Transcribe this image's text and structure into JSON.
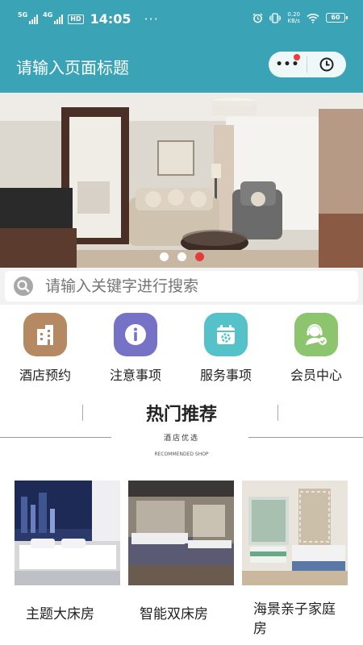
{
  "status_bar": {
    "net1": "5G",
    "net2": "4G",
    "hd": "HD",
    "time": "14:05",
    "more": "···",
    "speed_value": "0.20",
    "speed_unit": "KB/s",
    "battery": "60"
  },
  "nav": {
    "title": "请输入页面标题",
    "more_label": "•••"
  },
  "banner": {
    "slide_count": 3,
    "active_index": 2
  },
  "search": {
    "placeholder": "请输入关键字进行搜索"
  },
  "categories": [
    {
      "label": "酒店预约",
      "icon": "building-icon",
      "color": "#b58a63"
    },
    {
      "label": "注意事项",
      "icon": "info-icon",
      "color": "#7672c7"
    },
    {
      "label": "服务事项",
      "icon": "calendar-gear-icon",
      "color": "#55c1c9"
    },
    {
      "label": "会员中心",
      "icon": "customer-service-icon",
      "color": "#8cc56d"
    }
  ],
  "section": {
    "title": "热门推荐",
    "subtitle": "酒店优选",
    "subtitle_en": "RECOMMENDED SHOP"
  },
  "rooms": [
    {
      "name": "主题大床房"
    },
    {
      "name": "智能双床房"
    },
    {
      "name": "海景亲子家庭房"
    }
  ],
  "colors": {
    "primary": "#3aa3b6",
    "dot_active": "#e43a3a",
    "badge_red": "#ef3b3b"
  }
}
